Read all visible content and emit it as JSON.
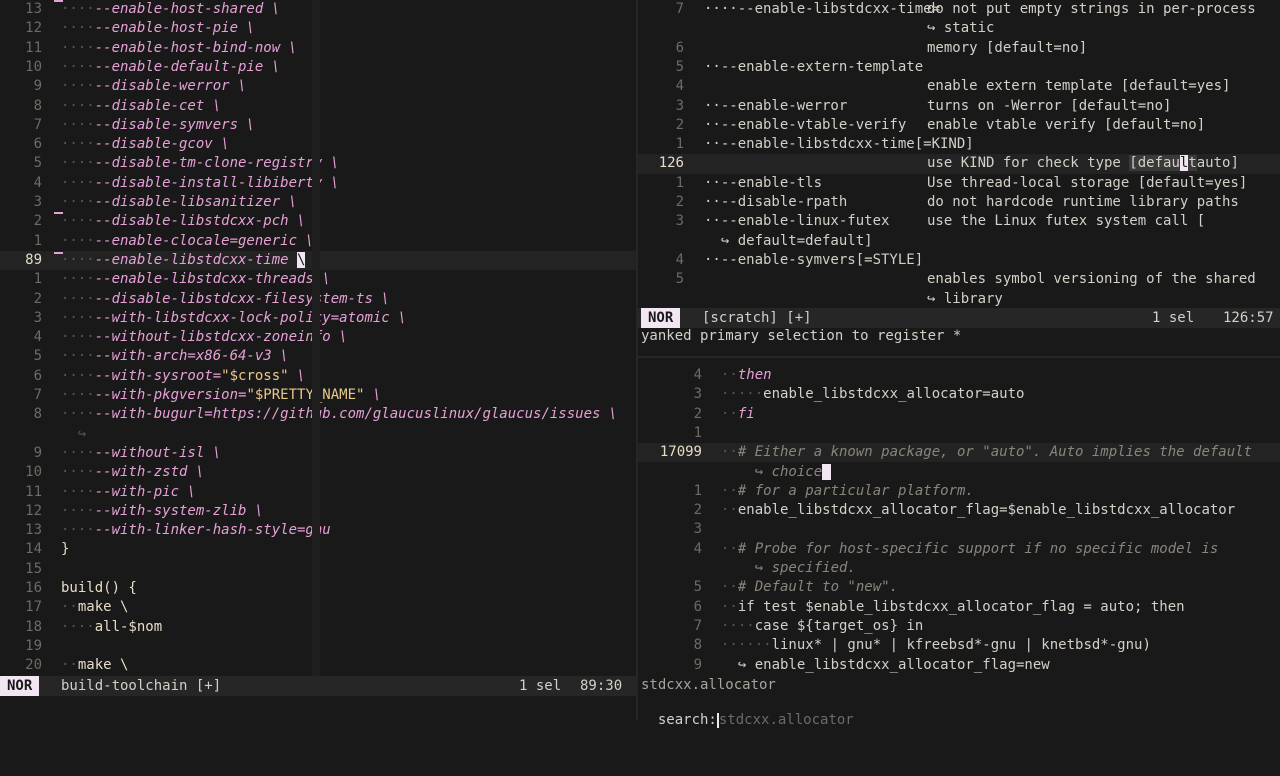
{
  "left_pane": {
    "lines": [
      {
        "n": "13",
        "t": "····--enable-host-shared \\"
      },
      {
        "n": "12",
        "t": "····--enable-host-pie \\"
      },
      {
        "n": "11",
        "t": "····--enable-host-bind-now \\"
      },
      {
        "n": "10",
        "t": "····--enable-default-pie \\"
      },
      {
        "n": "9",
        "t": "····--disable-werror \\"
      },
      {
        "n": "8",
        "t": "····--disable-cet \\"
      },
      {
        "n": "7",
        "t": "····--disable-symvers \\"
      },
      {
        "n": "6",
        "t": "····--disable-gcov \\"
      },
      {
        "n": "5",
        "t": "····--disable-tm-clone-registry \\"
      },
      {
        "n": "4",
        "t": "····--disable-install-libiberty \\"
      },
      {
        "n": "3",
        "t": "····--disable-libsanitizer \\"
      },
      {
        "n": "2",
        "t": "····--disable-libstdcxx-pch \\"
      },
      {
        "n": "1",
        "t": "····--enable-clocale=generic \\"
      },
      {
        "n": "89",
        "t": "····--enable-libstdcxx-time ",
        "cursor": "\\",
        "current": true
      },
      {
        "n": "1",
        "t": "····--enable-libstdcxx-threads \\"
      },
      {
        "n": "2",
        "t": "····--disable-libstdcxx-filesystem-ts \\"
      },
      {
        "n": "3",
        "t": "····--with-libstdcxx-lock-policy=atomic \\"
      },
      {
        "n": "4",
        "t": "····--without-libstdcxx-zoneinfo \\"
      },
      {
        "n": "5",
        "t": "····--with-arch=x86-64-v3 \\"
      },
      {
        "n": "6",
        "t": "····--with-sysroot=\"$cross\" \\"
      },
      {
        "n": "7",
        "t": "····--with-pkgversion=\"$PRETTY_NAME\" \\"
      },
      {
        "n": "8",
        "t": "····--with-bugurl=https://github.com/glaucuslinux/glaucus/issues \\"
      },
      {
        "n": "",
        "t": "  ↪"
      },
      {
        "n": "9",
        "t": "····--without-isl \\"
      },
      {
        "n": "10",
        "t": "····--with-zstd \\"
      },
      {
        "n": "11",
        "t": "····--with-pic \\"
      },
      {
        "n": "12",
        "t": "····--with-system-zlib \\"
      },
      {
        "n": "13",
        "t": "····--with-linker-hash-style=gnu"
      },
      {
        "n": "14",
        "t": "}"
      },
      {
        "n": "15",
        "t": ""
      },
      {
        "n": "16",
        "t": "build() {"
      },
      {
        "n": "17",
        "t": "··make \\"
      },
      {
        "n": "18",
        "t": "····all-$nom"
      },
      {
        "n": "19",
        "t": ""
      },
      {
        "n": "20",
        "t": "··make \\"
      }
    ],
    "status": {
      "mode": "NOR",
      "file": "build-toolchain [+]",
      "sel": "1 sel",
      "pos": "89:30"
    }
  },
  "right_top_pane": {
    "lines": [
      {
        "n": "7",
        "t": "····--enable-libstdcxx-time=",
        "a": "do not put empty strings in per-process"
      },
      {
        "n": "",
        "t": "",
        "a": "↪ static"
      },
      {
        "n": "6",
        "t": "",
        "a": "memory [default=no]"
      },
      {
        "n": "5",
        "t": "··--enable-extern-template",
        "a": ""
      },
      {
        "n": "4",
        "t": "",
        "a": "enable extern template [default=yes]"
      },
      {
        "n": "3",
        "t": "··--enable-werror",
        "a": "turns on -Werror [default=no]"
      },
      {
        "n": "2",
        "t": "··--enable-vtable-verify",
        "a": "enable vtable verify [default=no]"
      },
      {
        "n": "1",
        "t": "··--enable-libstdcxx-time[=KIND]",
        "a": ""
      },
      {
        "n": "126",
        "t": "",
        "a": "use KIND for check type [default=auto]",
        "current": true
      },
      {
        "n": "1",
        "t": "··--enable-tls",
        "a": "Use thread-local storage [default=yes]"
      },
      {
        "n": "2",
        "t": "··--disable-rpath",
        "a": "do not hardcode runtime library paths"
      },
      {
        "n": "3",
        "t": "··--enable-linux-futex",
        "a": "use the Linux futex system call ["
      },
      {
        "n": "",
        "t": "  ↪ default=default]",
        "a": ""
      },
      {
        "n": "4",
        "t": "··--enable-symvers[=STYLE]",
        "a": ""
      },
      {
        "n": "5",
        "t": "",
        "a": "enables symbol versioning of the shared"
      },
      {
        "n": "",
        "t": "",
        "a": "↪ library"
      }
    ],
    "status": {
      "mode": "NOR",
      "file": "[scratch] [+]",
      "sel": "1 sel",
      "pos": "126:57"
    },
    "message": "yanked primary selection to register *"
  },
  "right_bottom_pane": {
    "lines": [
      {
        "n": "4",
        "t": "··then",
        "k": "kw"
      },
      {
        "n": "3",
        "t": "·····enable_libstdcxx_allocator=auto",
        "k": "plain"
      },
      {
        "n": "2",
        "t": "··fi",
        "k": "kw"
      },
      {
        "n": "1",
        "t": "",
        "k": "plain"
      },
      {
        "n": "17099",
        "t": "··# Either a known package, or \"auto\". Auto implies the default",
        "k": "cm",
        "current": true
      },
      {
        "n": "",
        "t": "    ↪ choice",
        "k": "cm",
        "cursor": true
      },
      {
        "n": "1",
        "t": "··# for a particular platform.",
        "k": "cm"
      },
      {
        "n": "2",
        "t": "··enable_libstdcxx_allocator_flag=$enable_libstdcxx_allocator",
        "k": "plain"
      },
      {
        "n": "3",
        "t": "",
        "k": "plain"
      },
      {
        "n": "4",
        "t": "··# Probe for host-specific support if no specific model is",
        "k": "cm"
      },
      {
        "n": "",
        "t": "    ↪ specified.",
        "k": "cm"
      },
      {
        "n": "5",
        "t": "··# Default to \"new\".",
        "k": "cm"
      },
      {
        "n": "6",
        "t": "··if test $enable_libstdcxx_allocator_flag = auto; then",
        "k": "plain"
      },
      {
        "n": "7",
        "t": "····case ${target_os} in",
        "k": "plain"
      },
      {
        "n": "8",
        "t": "······linux* | gnu* | kfreebsd*-gnu | knetbsd*-gnu)",
        "k": "plain"
      },
      {
        "n": "9",
        "t": "  ↪ enable_libstdcxx_allocator_flag=new",
        "k": "plain"
      }
    ],
    "completion": "stdcxx.allocator",
    "search_prompt": "search:",
    "search_value": "stdcxx.allocator"
  }
}
